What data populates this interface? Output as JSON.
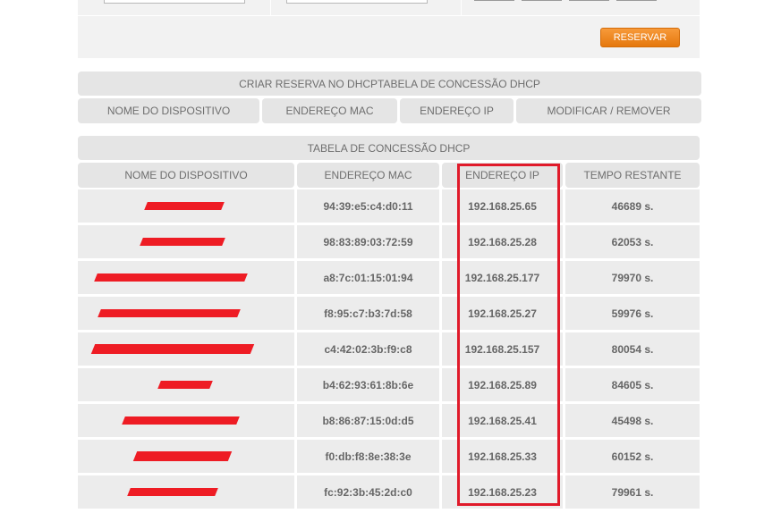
{
  "top": {
    "reserve_label": "RESERVAR"
  },
  "reservation_section": {
    "title": "CRIAR RESERVA NO DHCPTABELA DE CONCESSÃO DHCP",
    "columns": [
      "NOME DO DISPOSITIVO",
      "ENDEREÇO MAC",
      "ENDEREÇO IP",
      "MODIFICAR / REMOVER"
    ]
  },
  "lease_table": {
    "title": "TABELA DE CONCESSÃO DHCP",
    "columns": [
      "NOME DO DISPOSITIVO",
      "ENDEREÇO MAC",
      "ENDEREÇO IP",
      "TEMPO RESTANTE"
    ],
    "rows": [
      {
        "mac": "94:39:e5:c4:d0:11",
        "ip": "192.168.25.65",
        "time": "46689 s."
      },
      {
        "mac": "98:83:89:03:72:59",
        "ip": "192.168.25.28",
        "time": "62053 s."
      },
      {
        "mac": "a8:7c:01:15:01:94",
        "ip": "192.168.25.177",
        "time": "79970 s."
      },
      {
        "mac": "f8:95:c7:b3:7d:58",
        "ip": "192.168.25.27",
        "time": "59976 s."
      },
      {
        "mac": "c4:42:02:3b:f9:c8",
        "ip": "192.168.25.157",
        "time": "80054 s."
      },
      {
        "mac": "b4:62:93:61:8b:6e",
        "ip": "192.168.25.89",
        "time": "84605 s."
      },
      {
        "mac": "b8:86:87:15:0d:d5",
        "ip": "192.168.25.41",
        "time": "45498 s."
      },
      {
        "mac": "f0:db:f8:8e:38:3e",
        "ip": "192.168.25.33",
        "time": "60152 s."
      },
      {
        "mac": "fc:92:3b:45:2d:c0",
        "ip": "192.168.25.23",
        "time": "79961 s."
      }
    ]
  },
  "colors": {
    "accent_orange": "#f08a24",
    "highlight_red": "#e01a2a",
    "redaction_red": "#ee1c24"
  }
}
